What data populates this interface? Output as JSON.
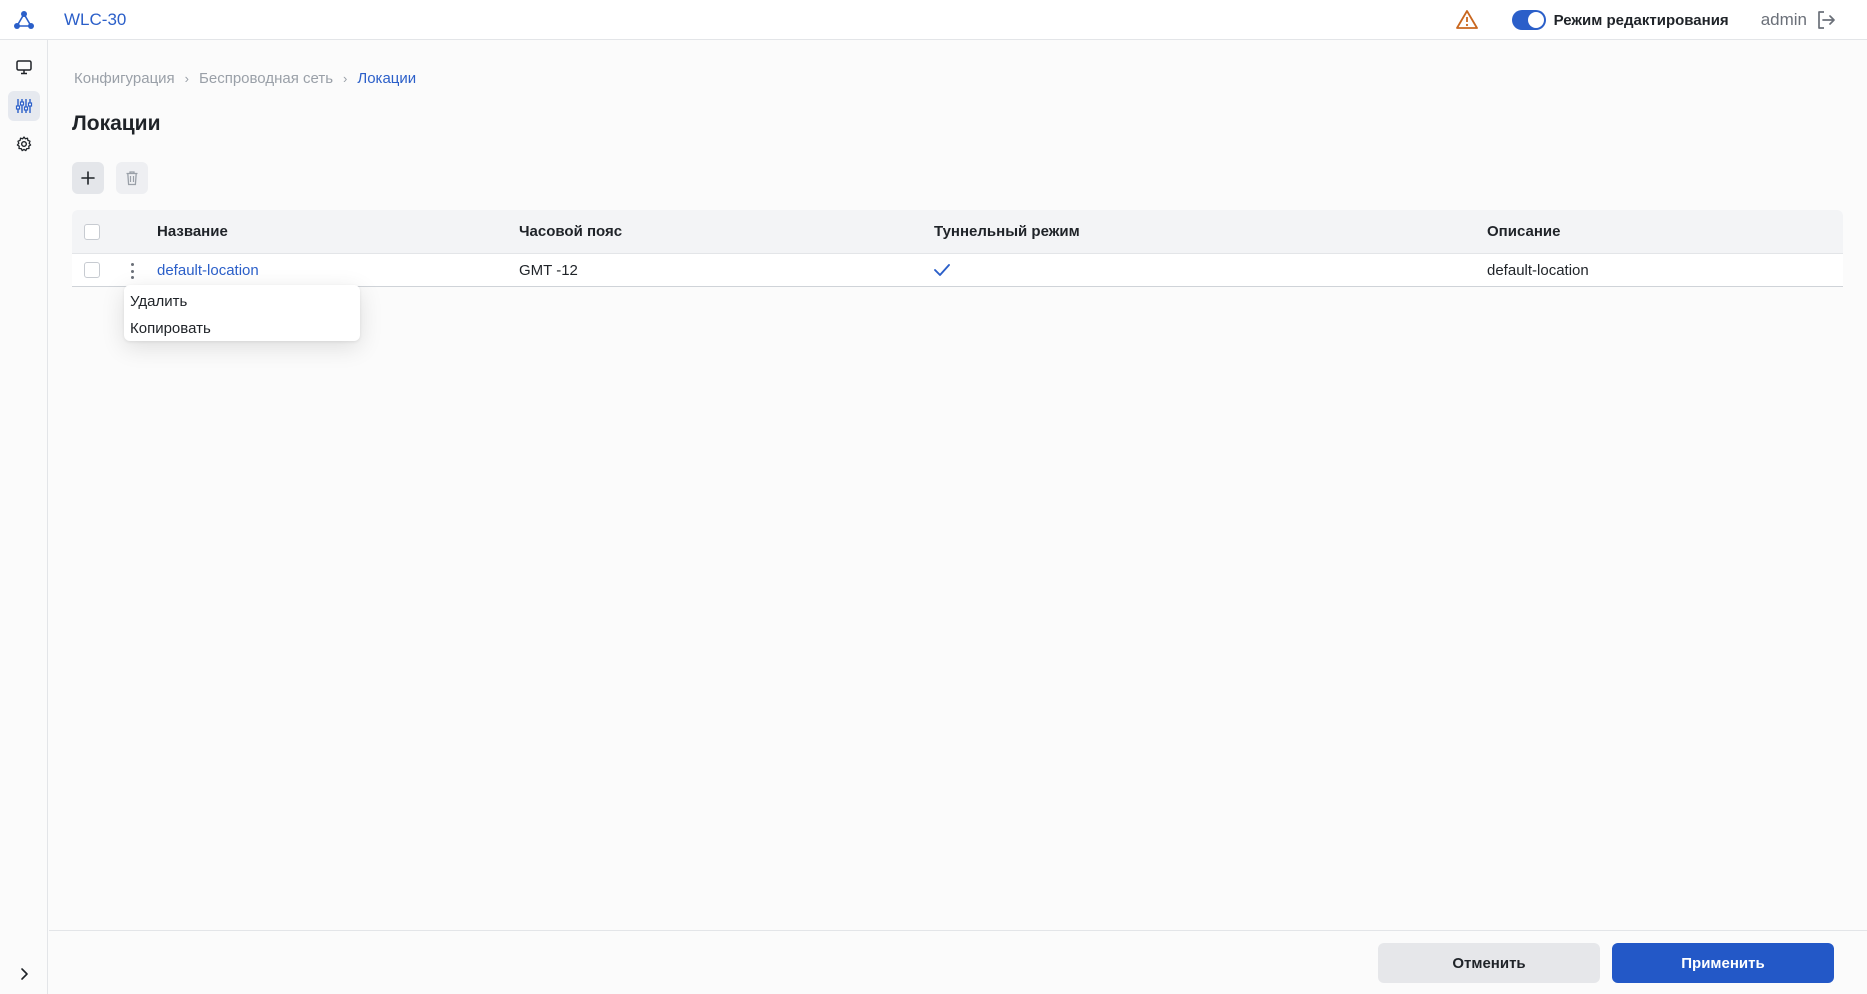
{
  "app": {
    "title": "WLC-30"
  },
  "header": {
    "edit_mode_label": "Режим редактирования",
    "user": "admin",
    "edit_mode_on": true
  },
  "sidebar": {
    "items": [
      {
        "icon": "monitor-icon"
      },
      {
        "icon": "sliders-icon",
        "active": true
      },
      {
        "icon": "gear-icon"
      }
    ]
  },
  "breadcrumb": [
    "Конфигурация",
    "Беспроводная сеть",
    "Локации"
  ],
  "page": {
    "title": "Локации"
  },
  "table": {
    "columns": [
      "Название",
      "Часовой пояс",
      "Туннельный режим",
      "Описание"
    ],
    "rows": [
      {
        "name": "default-location",
        "timezone": "GMT -12",
        "tunnel": true,
        "description": "default-location"
      }
    ]
  },
  "context_menu": {
    "items": [
      "Удалить",
      "Копировать"
    ]
  },
  "footer": {
    "cancel_label": "Отменить",
    "apply_label": "Применить"
  },
  "colors": {
    "accent": "#2b5fc9",
    "warning": "#c9671f",
    "apply": "#2358c7"
  }
}
